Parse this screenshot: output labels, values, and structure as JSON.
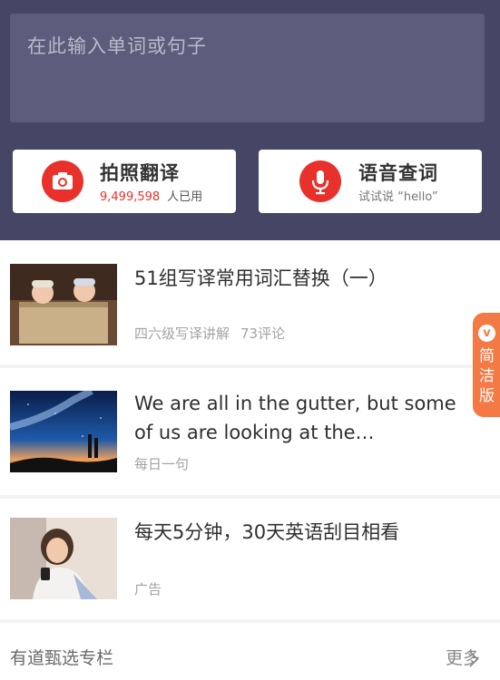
{
  "search": {
    "placeholder": "在此输入单词或句子"
  },
  "actions": {
    "photo": {
      "title": "拍照翻译",
      "count": "9,499,598",
      "count_suffix": "人已用",
      "icon": "camera-icon"
    },
    "voice": {
      "title": "语音查词",
      "subtitle": "试试说 “hello”",
      "icon": "microphone-icon"
    }
  },
  "feed": [
    {
      "title": "51组写译常用词汇替换（一）",
      "meta": [
        "四六级写译讲解",
        "73评论"
      ]
    },
    {
      "title": "We are all in the gutter, but some of us are looking at the…",
      "meta": [
        "每日一句"
      ]
    },
    {
      "title": "每天5分钟，30天英语刮目相看",
      "meta": [
        "广告"
      ]
    }
  ],
  "side_tab": {
    "logo": "v",
    "label": "简洁版"
  },
  "section": {
    "title": "有道甄选专栏",
    "more_label": "更多"
  },
  "colors": {
    "header_bg": "#454565",
    "search_bg": "#5c5c7c",
    "accent_red": "#e8312b",
    "side_tab": "#f47a45"
  }
}
